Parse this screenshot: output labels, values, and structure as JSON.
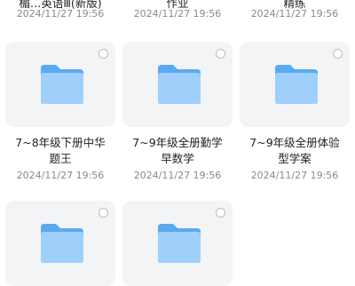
{
  "top_row": [
    {
      "title": "楣…英语Ⅲ(新版)",
      "date": "2024/11/27 19:56"
    },
    {
      "title": "作业",
      "date": "2024/11/27 19:56"
    },
    {
      "title": "精练",
      "date": "2024/11/27 19:56"
    }
  ],
  "folders": [
    {
      "name_line1": "7~8年级下册中华",
      "name_line2": "题王",
      "date": "2024/11/27 19:56"
    },
    {
      "name_line1": "7~9年级全册勤学",
      "name_line2": "早数学",
      "date": "2024/11/27 19:56"
    },
    {
      "name_line1": "7~9年级全册体验",
      "name_line2": "型学案",
      "date": "2024/11/27 19:56"
    },
    {
      "name_line1": "",
      "name_line2": "",
      "date": ""
    },
    {
      "name_line1": "",
      "name_line2": "",
      "date": ""
    }
  ],
  "icons": {
    "folder": "folder-icon",
    "select": "select-circle-icon"
  },
  "colors": {
    "folder_light": "#9fd0fb",
    "folder_dark": "#5aaaf1",
    "card_bg": "#f3f4f6"
  }
}
